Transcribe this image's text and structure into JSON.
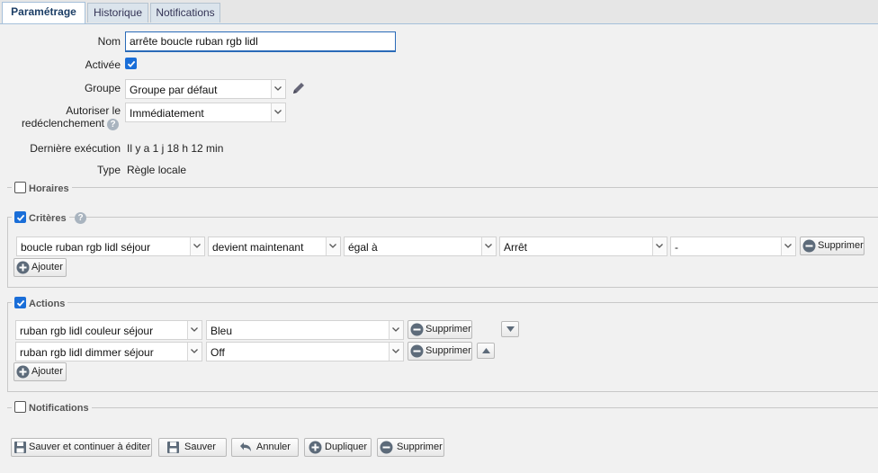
{
  "tabs": [
    {
      "label": "Paramétrage"
    },
    {
      "label": "Historique"
    },
    {
      "label": "Notifications"
    }
  ],
  "form": {
    "nom_label": "Nom",
    "nom_value": "arrête boucle ruban rgb lidl",
    "activee_label": "Activée",
    "groupe_label": "Groupe",
    "groupe_value": "Groupe par défaut",
    "autoriser_label_1": "Autoriser le",
    "autoriser_label_2": "redéclenchement",
    "autoriser_value": "Immédiatement",
    "derniere_label": "Dernière exécution",
    "derniere_value": "Il y a 1 j 18 h 12 min",
    "type_label": "Type",
    "type_value": "Règle locale"
  },
  "sections": {
    "horaires": "Horaires",
    "criteres": "Critères",
    "actions": "Actions",
    "notifications": "Notifications"
  },
  "criteria": {
    "device": "boucle ruban rgb lidl séjour",
    "condition": "devient maintenant",
    "operator": "égal à",
    "value": "Arrêt",
    "extra": "-",
    "delete_label": "Supprimer",
    "add_label": "Ajouter"
  },
  "actions": {
    "rows": [
      {
        "device": "ruban rgb lidl couleur séjour",
        "value": "Bleu",
        "delete_label": "Supprimer"
      },
      {
        "device": "ruban rgb lidl dimmer séjour",
        "value": "Off",
        "delete_label": "Supprimer"
      }
    ],
    "add_label": "Ajouter"
  },
  "footer": {
    "save_continue": "Sauver et continuer à éditer",
    "save": "Sauver",
    "cancel": "Annuler",
    "duplicate": "Dupliquer",
    "delete": "Supprimer"
  },
  "icons": {
    "edit": "pencil-icon",
    "help": "help-icon",
    "dropdown": "chevron-down-icon",
    "save": "floppy-disk-icon",
    "undo": "undo-arrow-icon",
    "plus": "plus-circle-icon",
    "minus": "minus-circle-icon"
  },
  "colors": {
    "accent": "#1a6ed8",
    "tab_active_text": "#1c3e66"
  }
}
